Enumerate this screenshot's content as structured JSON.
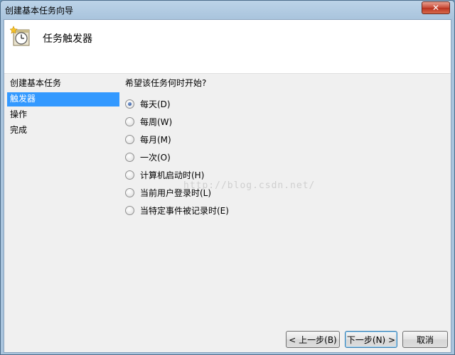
{
  "window": {
    "title": "创建基本任务向导",
    "close_glyph": "✕"
  },
  "header": {
    "title": "任务触发器",
    "icon": "clock-calendar-icon"
  },
  "sidebar": {
    "items": [
      {
        "label": "创建基本任务",
        "active": false
      },
      {
        "label": "触发器",
        "active": true
      },
      {
        "label": "操作",
        "active": false
      },
      {
        "label": "完成",
        "active": false
      }
    ]
  },
  "content": {
    "question": "希望该任务何时开始?",
    "options": [
      {
        "label": "每天(D)",
        "checked": true
      },
      {
        "label": "每周(W)",
        "checked": false
      },
      {
        "label": "每月(M)",
        "checked": false
      },
      {
        "label": "一次(O)",
        "checked": false
      },
      {
        "label": "计算机启动时(H)",
        "checked": false
      },
      {
        "label": "当前用户登录时(L)",
        "checked": false
      },
      {
        "label": "当特定事件被记录时(E)",
        "checked": false
      }
    ],
    "watermark": "http://blog.csdn.net/"
  },
  "footer": {
    "back_label": "< 上一步(B)",
    "next_label": "下一步(N) >",
    "cancel_label": "取消"
  },
  "colors": {
    "selection": "#3399ff",
    "client_bg": "#f0f0f0"
  }
}
